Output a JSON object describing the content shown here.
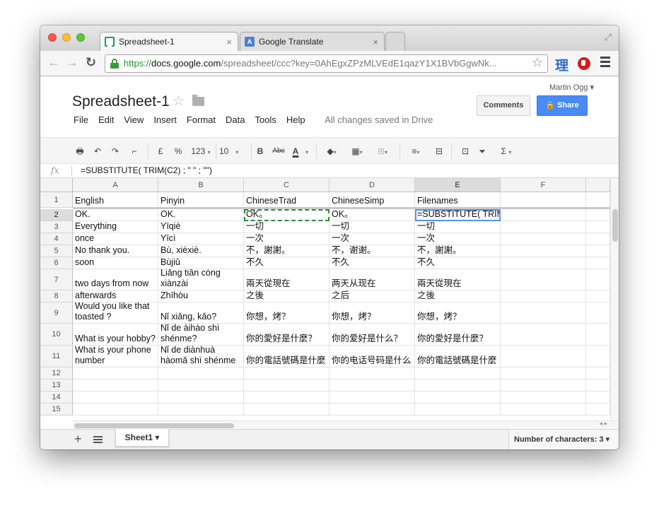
{
  "browser": {
    "tabs": [
      {
        "title": "Spreadsheet-1",
        "favicon": "sheets-icon",
        "active": true
      },
      {
        "title": "Google Translate",
        "favicon": "translate-icon",
        "active": false
      }
    ],
    "url": {
      "scheme": "https://",
      "host": "docs.google.com",
      "path": "/spreadsheet/ccc?key=0AhEgxZPzMLVEdE1qazY1X1BVbGgwNk..."
    },
    "extension_label": "理"
  },
  "docs": {
    "title": "Spreadsheet-1",
    "user": "Martin Ogg ▾",
    "comments_label": "Comments",
    "share_label": "Share",
    "menu": [
      "File",
      "Edit",
      "View",
      "Insert",
      "Format",
      "Data",
      "Tools",
      "Help"
    ],
    "save_status": "All changes saved in Drive"
  },
  "toolbar": {
    "currency": "£",
    "percent": "%",
    "number_format": "123",
    "font_size": "10",
    "bold": "B",
    "strike": "Abc",
    "font_color": "A",
    "sigma": "Σ"
  },
  "formula_bar": {
    "fx_label": "fx",
    "formula": "=SUBSTITUTE( TRIM(C2) ; \" \" ; \"\")"
  },
  "grid": {
    "columns": [
      "A",
      "B",
      "C",
      "D",
      "E",
      "F"
    ],
    "selected_column": "E",
    "rows": [
      {
        "num": "1",
        "cells": [
          "English",
          "Pinyin",
          "ChineseTrad",
          "ChineseSimp",
          "Filenames",
          ""
        ]
      },
      {
        "num": "2",
        "cells": [
          "OK.",
          "OK.",
          "OK。",
          "OK。",
          "",
          ""
        ]
      },
      {
        "num": "3",
        "cells": [
          "Everything",
          "Yīqiè",
          "一切",
          "一切",
          "一切",
          ""
        ]
      },
      {
        "num": "4",
        "cells": [
          "once",
          "Yīcì",
          "一次",
          "一次",
          "一次",
          ""
        ]
      },
      {
        "num": "5",
        "cells": [
          "No thank you.",
          "Bù, xièxiè.",
          "不，謝謝。",
          "不，谢谢。",
          "不，謝謝。",
          ""
        ]
      },
      {
        "num": "6",
        "cells": [
          "soon",
          "Bùjiǔ",
          "不久",
          "不久",
          "不久",
          ""
        ]
      },
      {
        "num": "7",
        "cells": [
          "two days from now",
          "Liǎng tiān cóng xiànzài",
          "兩天從現在",
          "两天从现在",
          "兩天從現在",
          ""
        ]
      },
      {
        "num": "8",
        "cells": [
          "afterwards",
          "Zhīhòu",
          "之後",
          "之后",
          "之後",
          ""
        ]
      },
      {
        "num": "9",
        "cells": [
          "Would you like that toasted ?",
          "Nǐ xiǎng, kǎo?",
          "你想，烤？",
          "你想，烤？",
          "你想，烤？",
          ""
        ]
      },
      {
        "num": "10",
        "cells": [
          "What is your hobby?",
          "Nǐ de àihào shì shénme?",
          "你的愛好是什麼？",
          "你的爱好是什么？",
          "你的愛好是什麼？",
          ""
        ]
      },
      {
        "num": "11",
        "cells": [
          "What is your phone number",
          "Nǐ de diànhuà hàomǎ shì shénme",
          "你的電話號碼是什麼",
          "你的电话号码是什么",
          "你的電話號碼是什麼",
          ""
        ]
      },
      {
        "num": "12",
        "cells": [
          "",
          "",
          "",
          "",
          "",
          ""
        ]
      },
      {
        "num": "13",
        "cells": [
          "",
          "",
          "",
          "",
          "",
          ""
        ]
      },
      {
        "num": "14",
        "cells": [
          "",
          "",
          "",
          "",
          "",
          ""
        ]
      },
      {
        "num": "15",
        "cells": [
          "",
          "",
          "",
          "",
          "",
          ""
        ]
      }
    ],
    "active_cell": {
      "ref": "E2",
      "edit_prefix": "=SUBSTITUTE( TRIM(",
      "edit_ref": "C2",
      "edit_suffix": ") ; \" \" ; \"\")"
    },
    "copied_cell": "C2"
  },
  "sheetbar": {
    "sheet_name": "Sheet1 ▾",
    "status": "Number of characters: 3 ▾"
  },
  "colors": {
    "accent": "#4a8af4",
    "copy_border": "#2e8b3e",
    "active_border": "#5b8ff0",
    "https": "#1f9a2c"
  }
}
